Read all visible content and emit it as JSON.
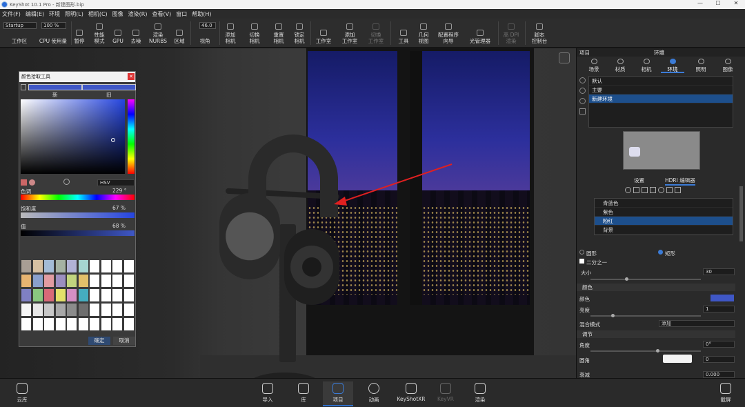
{
  "window": {
    "title": "KeyShot 10.1 Pro - 新建图形.bip",
    "minimize": "—",
    "maximize": "☐",
    "close": "✕"
  },
  "menu": [
    "文件(F)",
    "编辑(E)",
    "环境",
    "照明(L)",
    "相机(C)",
    "图像",
    "渲染(R)",
    "查看(V)",
    "窗口",
    "帮助(H)"
  ],
  "toolbar": {
    "workspace_value": "Startup",
    "cpu_value": "100 %",
    "fov_value": "46.0",
    "items": [
      {
        "label": "工作区",
        "name": "workspace"
      },
      {
        "label": "CPU 使用量",
        "name": "cpu-usage"
      },
      {
        "label": "暂停",
        "name": "pause"
      },
      {
        "label": "性能\n模式",
        "name": "performance-mode"
      },
      {
        "label": "GPU",
        "name": "gpu"
      },
      {
        "label": "去噪",
        "name": "denoise"
      },
      {
        "label": "渲染\nNURBS",
        "name": "render-nurbs"
      },
      {
        "label": "区域",
        "name": "region"
      },
      {
        "label": "视角",
        "name": "view-angle"
      },
      {
        "label": "添加\n相机",
        "name": "add-camera"
      },
      {
        "label": "切换\n相机",
        "name": "switch-camera"
      },
      {
        "label": "重置\n相机",
        "name": "reset-camera"
      },
      {
        "label": "锁定\n相机",
        "name": "lock-camera"
      },
      {
        "label": "工作室",
        "name": "studio"
      },
      {
        "label": "添加\n工作室",
        "name": "add-studio"
      },
      {
        "label": "切换\n工作室",
        "name": "switch-studio"
      },
      {
        "label": "工具",
        "name": "tools"
      },
      {
        "label": "几何\n视图",
        "name": "geometry-view"
      },
      {
        "label": "配置程序\n向导",
        "name": "configurator-wizard"
      },
      {
        "label": "光管理器",
        "name": "light-manager"
      },
      {
        "label": "高 DPI\n渲染",
        "name": "high-dpi-render"
      },
      {
        "label": "脚本\n控制台",
        "name": "script-console"
      }
    ]
  },
  "color_picker": {
    "title": "颜色拾取工具",
    "new_label": "新",
    "old_label": "旧",
    "mode": "HSV",
    "hue_label": "色调",
    "hue_value": "229 °",
    "saturation_label": "饱和度",
    "saturation_value": "67 %",
    "value_label": "值",
    "value_value": "68 %",
    "ok": "确定",
    "cancel": "取消",
    "swatches": [
      "#a99e94",
      "#d7c1a3",
      "#a4bcd7",
      "#a5b2a3",
      "#b1b2d6",
      "#a6d5d0",
      "#e8b471",
      "#8aa0cd",
      "#e29ca1",
      "#9c8fc0",
      "#c2d47f",
      "#e1c06a",
      "#7f80c3",
      "#8ac77f",
      "#d86a78",
      "#e3e06a",
      "#d38fc4",
      "#45adc0",
      "#f5f5f5",
      "#e8e8e8",
      "#c8c8c8",
      "#a8a8a8",
      "#8c8c8c",
      "#6e6e6e"
    ]
  },
  "right_panel": {
    "project_label": "项目",
    "panel_title": "环境",
    "tabs": [
      "场景",
      "材质",
      "相机",
      "环境",
      "照明",
      "图像"
    ],
    "active_tab": "环境",
    "environments": [
      "默认",
      "主要",
      "新建环境"
    ],
    "selected_env": "新建环境",
    "subtabs": [
      "设置",
      "HDRI 编辑器"
    ],
    "pins": [
      "青蓝色",
      "紫色",
      "粉红",
      "背景"
    ],
    "selected_pin": "粉红",
    "shape_circle": "圆形",
    "shape_rect": "矩形",
    "half_label": "二分之一",
    "size_label": "大小",
    "size_value": "30",
    "color_section": "颜色",
    "color_label": "颜色",
    "color_swatch": "#3f57c6",
    "brightness_label": "亮度",
    "brightness_value": "1",
    "blend_label": "混合模式",
    "blend_value": "添加",
    "adjust_section": "调节",
    "angle_label": "角度",
    "angle_value": "0°",
    "rounding_label": "圆角",
    "rounding_value": "0",
    "falloff_label": "衰减",
    "falloff_value": "0.000"
  },
  "bottombar": [
    {
      "label": "云库",
      "name": "cloud-library"
    },
    {
      "label": "导入",
      "name": "import"
    },
    {
      "label": "库",
      "name": "library"
    },
    {
      "label": "项目",
      "name": "project",
      "active": true
    },
    {
      "label": "动画",
      "name": "animation"
    },
    {
      "label": "KeyShotXR",
      "name": "keyshotxr"
    },
    {
      "label": "KeyVR",
      "name": "keyvr",
      "dim": true
    },
    {
      "label": "渲染",
      "name": "render"
    },
    {
      "label": "截屏",
      "name": "screenshot"
    }
  ]
}
